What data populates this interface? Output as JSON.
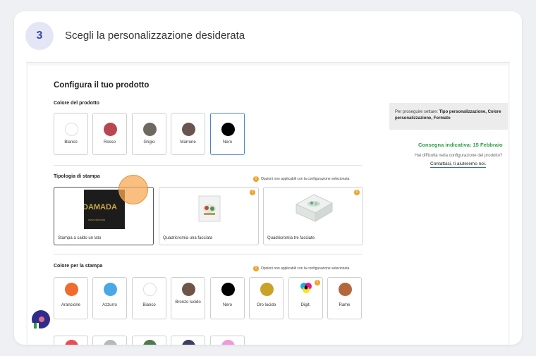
{
  "step": {
    "number": "3",
    "title": "Scegli la personalizzazione desiderata"
  },
  "config": {
    "title": "Configura il tuo prodotto",
    "product_color": {
      "label": "Colore del prodotto",
      "options": [
        {
          "label": "Bianco",
          "color": "#ffffff"
        },
        {
          "label": "Rosso",
          "color": "#b9474f"
        },
        {
          "label": "Grigio",
          "color": "#6e6860"
        },
        {
          "label": "Marrone",
          "color": "#6a5450"
        },
        {
          "label": "Nero",
          "color": "#000000",
          "selected": true
        }
      ]
    },
    "print_type": {
      "label": "Tipologia di stampa",
      "warning": "Opzioni non applicabili con la configurazione selezionata",
      "options": [
        {
          "label": "Stampa a caldo un lato",
          "selected": true,
          "image_text": "DAMADA"
        },
        {
          "label": "Quadricromia una facciata",
          "warning": true
        },
        {
          "label": "Quadricromia tre facciate",
          "warning": true
        }
      ]
    },
    "print_color": {
      "label": "Colore per la stampa",
      "warning": "Opzioni non applicabili con la configurazione selezionata",
      "options": [
        {
          "label": "Arancione",
          "color": "#f26a2e"
        },
        {
          "label": "Azzurro",
          "color": "#4aa8e6"
        },
        {
          "label": "Bianco",
          "color": "#ffffff"
        },
        {
          "label": "Bronzo lucido",
          "color": "#6e5548"
        },
        {
          "label": "Nero",
          "color": "#000000"
        },
        {
          "label": "Oro lucido",
          "color": "#c9a227"
        },
        {
          "label": "Digit.",
          "color": "cmyk",
          "warning": true
        },
        {
          "label": "Rame",
          "color": "#b4673a"
        }
      ],
      "partial_row_colors": [
        "#e94b57",
        "#b8b8b8",
        "#4f7a4f",
        "#3d3f60",
        "#ee9ad6"
      ]
    }
  },
  "sidebar": {
    "info_prefix": "Per proseguire settare: ",
    "info_bold": "Tipo personalizzazione, Colore personalizzazione, Formato",
    "delivery": "Consegna indicativa: 15 Febbraio",
    "help_question": "Hai difficoltà nella configurazione del prodotto?",
    "help_link": "Contattaci, ti aiuteremo noi."
  },
  "colors": {
    "accent": "#3d46a8",
    "success": "#2f9e44",
    "warning": "#f0a32a",
    "link_underline": "#2a6cb5"
  }
}
